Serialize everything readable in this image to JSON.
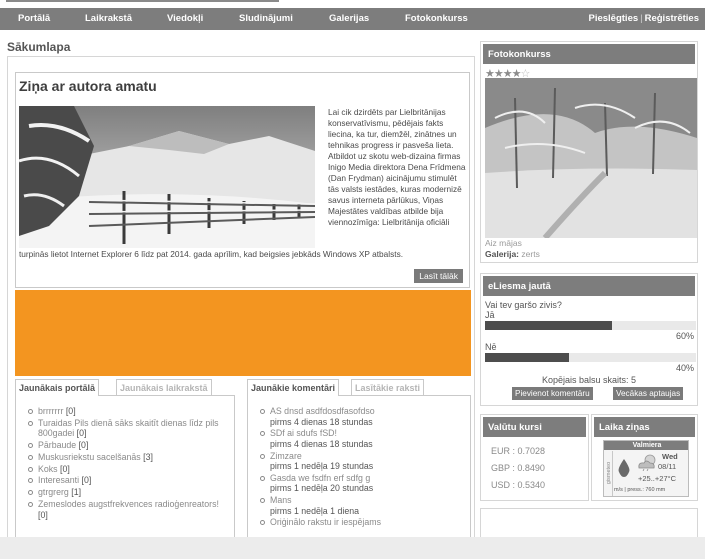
{
  "nav": {
    "items": [
      {
        "label": "Portālā"
      },
      {
        "label": "Laikrakstā"
      },
      {
        "label": "Viedokļi"
      },
      {
        "label": "Sludinājumi"
      },
      {
        "label": "Galerijas"
      },
      {
        "label": "Fotokonkurss"
      }
    ],
    "login": "Pieslēgties",
    "register": "Reģistrēties"
  },
  "page": {
    "title": "Sākumlapa"
  },
  "article": {
    "title": "Ziņa ar autora amatu",
    "text_side": "Lai cik dzirdēts par Lielbritānijas konservatīvismu, pēdējais fakts liecina, ka tur, diemžēl, zinātnes un tehnikas progress ir pasveša lieta. Atbildot uz skotu web-dizaina firmas Inigo Media direktora Dena Frīdmena (Dan Frydman) aicinājumu stimulēt tās valsts iestādes, kuras modernizē savus interneta pārlūkus, Viņas Majestātes valdības atbilde bija viennozīmīga: Lielbritānija oficiāli",
    "text_bottom": "turpinās lietot Internet Explorer 6 līdz pat 2014. gada aprīlim, kad beigsies jebkāds Windows XP atbalsts.",
    "read_more": "Lasīt tālāk"
  },
  "tabs_left": {
    "active": "Jaunākais portālā",
    "inactive": "Jaunākais laikrakstā",
    "items": [
      {
        "title": "brrrrrrr",
        "count": "[0]"
      },
      {
        "title": "Turaidas Pils dienā sāks skaitīt dienas līdz pils 800gadei",
        "count": "[0]"
      },
      {
        "title": "Pārbaude",
        "count": "[0]"
      },
      {
        "title": "Muskusriekstu sacelšanās",
        "count": "[3]"
      },
      {
        "title": "Koks",
        "count": "[0]"
      },
      {
        "title": "Interesanti",
        "count": "[0]"
      },
      {
        "title": "gtrgrerg",
        "count": "[1]"
      },
      {
        "title": "Zemeslodes augstfrekvences radioģenreators!",
        "count": "[0]"
      }
    ]
  },
  "tabs_right": {
    "active": "Jaunākie komentāri",
    "inactive": "Lasītākie raksti",
    "items": [
      {
        "title": "AS dnsd asdfdosdfasofdso",
        "meta": "pirms 4 dienas 18 stundas"
      },
      {
        "title": "SDf ai sdufs fSD!",
        "meta": "pirms 4 dienas 18 stundas"
      },
      {
        "title": "Zimzare",
        "meta": "pirms 1 nedēļa 19 stundas"
      },
      {
        "title": "Gasda we fsdfn erf sdfg g",
        "meta": "pirms 1 nedēļa 20 stundas"
      },
      {
        "title": "Mans",
        "meta": "pirms 1 nedēļa 1 diena"
      },
      {
        "title": "Oriģinālo rakstu ir iespējams",
        "meta": ""
      }
    ]
  },
  "photo_contest": {
    "title": "Fotokonkurss",
    "rating": 4,
    "rating_max": 5,
    "caption": "Aiz mājas",
    "gallery_label": "Galerija:",
    "gallery_name": "zerts"
  },
  "poll": {
    "title": "eLiesma jautā",
    "question": "Vai tev garšo zivis?",
    "options": [
      {
        "label": "Jā",
        "percent": 60,
        "percent_text": "60%"
      },
      {
        "label": "Nē",
        "percent": 40,
        "percent_text": "40%"
      }
    ],
    "total": "Kopējais balsu skaits: 5",
    "comment_btn": "Pievienot komentāru",
    "older_btn": "Vecākas aptaujas"
  },
  "currency": {
    "title": "Valūtu kursi",
    "rates": [
      {
        "label": "EUR : 0.7028"
      },
      {
        "label": "GBP : 0.8490"
      },
      {
        "label": "USD : 0.5340"
      }
    ]
  },
  "weather": {
    "title": "Laika ziņas",
    "city": "Valmiera",
    "side": "gismeteo",
    "day": "Wed",
    "date": "08/11",
    "temp": "+25..+27°C",
    "press": "m/s | press.: 760 mm"
  },
  "colors": {
    "header_bg": "#7d7d7d",
    "banner": "#f39520",
    "bar_fill": "#4d4d4d"
  }
}
